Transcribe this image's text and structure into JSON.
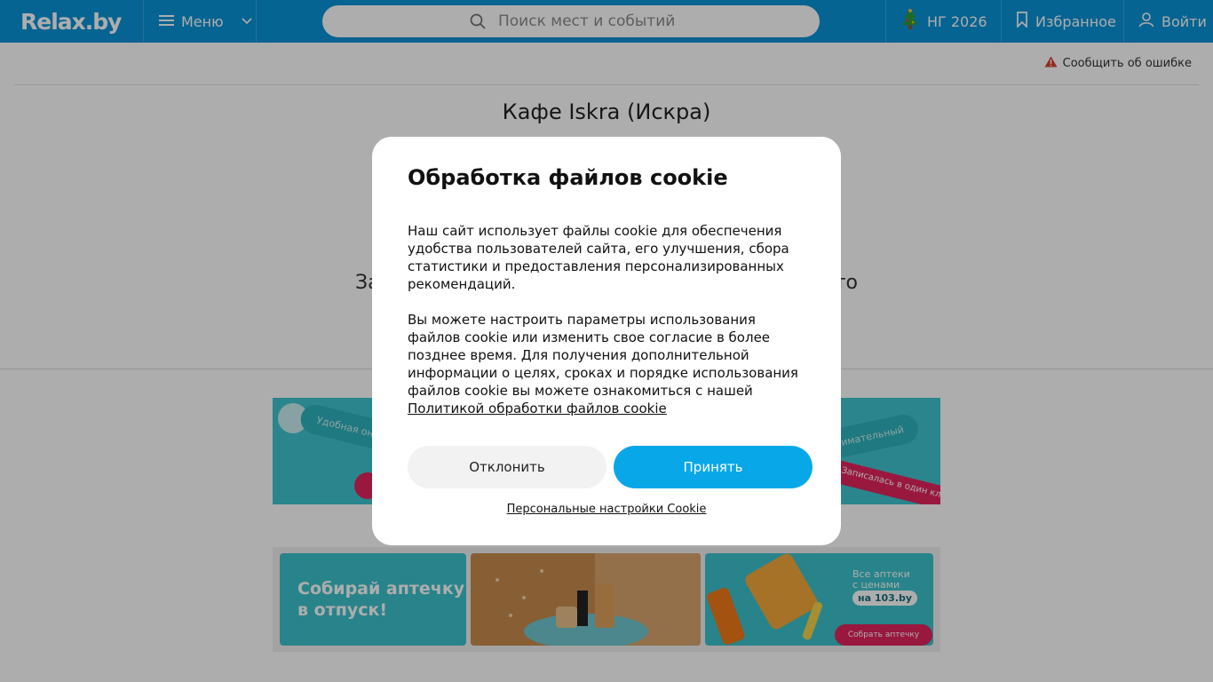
{
  "header": {
    "logo": "Relax.by",
    "menu_label": "Меню",
    "search_placeholder": "Поиск мест и событий",
    "ng_label": "НГ 2026",
    "favorites_label": "Избранное",
    "login_label": "Войти"
  },
  "page": {
    "report_error": "Сообщить об ошибке",
    "title": "Кафе Iskra (Искра)",
    "bg_text_left": "За",
    "bg_text_right": "то"
  },
  "banners": {
    "banner1_pill_left": "Удобная он",
    "banner1_pill_right": "внимательный",
    "banner1_strip": "Записалась в один кл",
    "banner2_left_line1": "Собирай аптечку",
    "banner2_left_line2": "в отпуск!",
    "banner2_right_text1": "Все аптеки",
    "banner2_right_text2": "с ценами",
    "banner2_right_badge": "на 103.by",
    "banner2_right_button": "Собрать аптечку"
  },
  "cookie_modal": {
    "title": "Обработка файлов cookie",
    "paragraph1": "Наш сайт использует файлы cookie для обеспечения удобства пользователей сайта, его улучшения, сбора статистики и предоставления персонализированных рекомендаций.",
    "paragraph2": "Вы можете настроить параметры использования файлов cookie или изменить свое согласие в более позднее время. Для получения дополнительной информации о целях, сроках и порядке использования файлов cookie вы можете ознакомиться с нашей",
    "policy_link": "Политикой обработки файлов cookie",
    "decline_label": "Отклонить",
    "accept_label": "Принять",
    "settings_link": "Персональные настройки Cookie"
  },
  "colors": {
    "header_bg": "#0a94d8",
    "accept_bg": "#08a8e8",
    "banner_teal": "#3cc3cc",
    "warning": "#d9412b"
  }
}
